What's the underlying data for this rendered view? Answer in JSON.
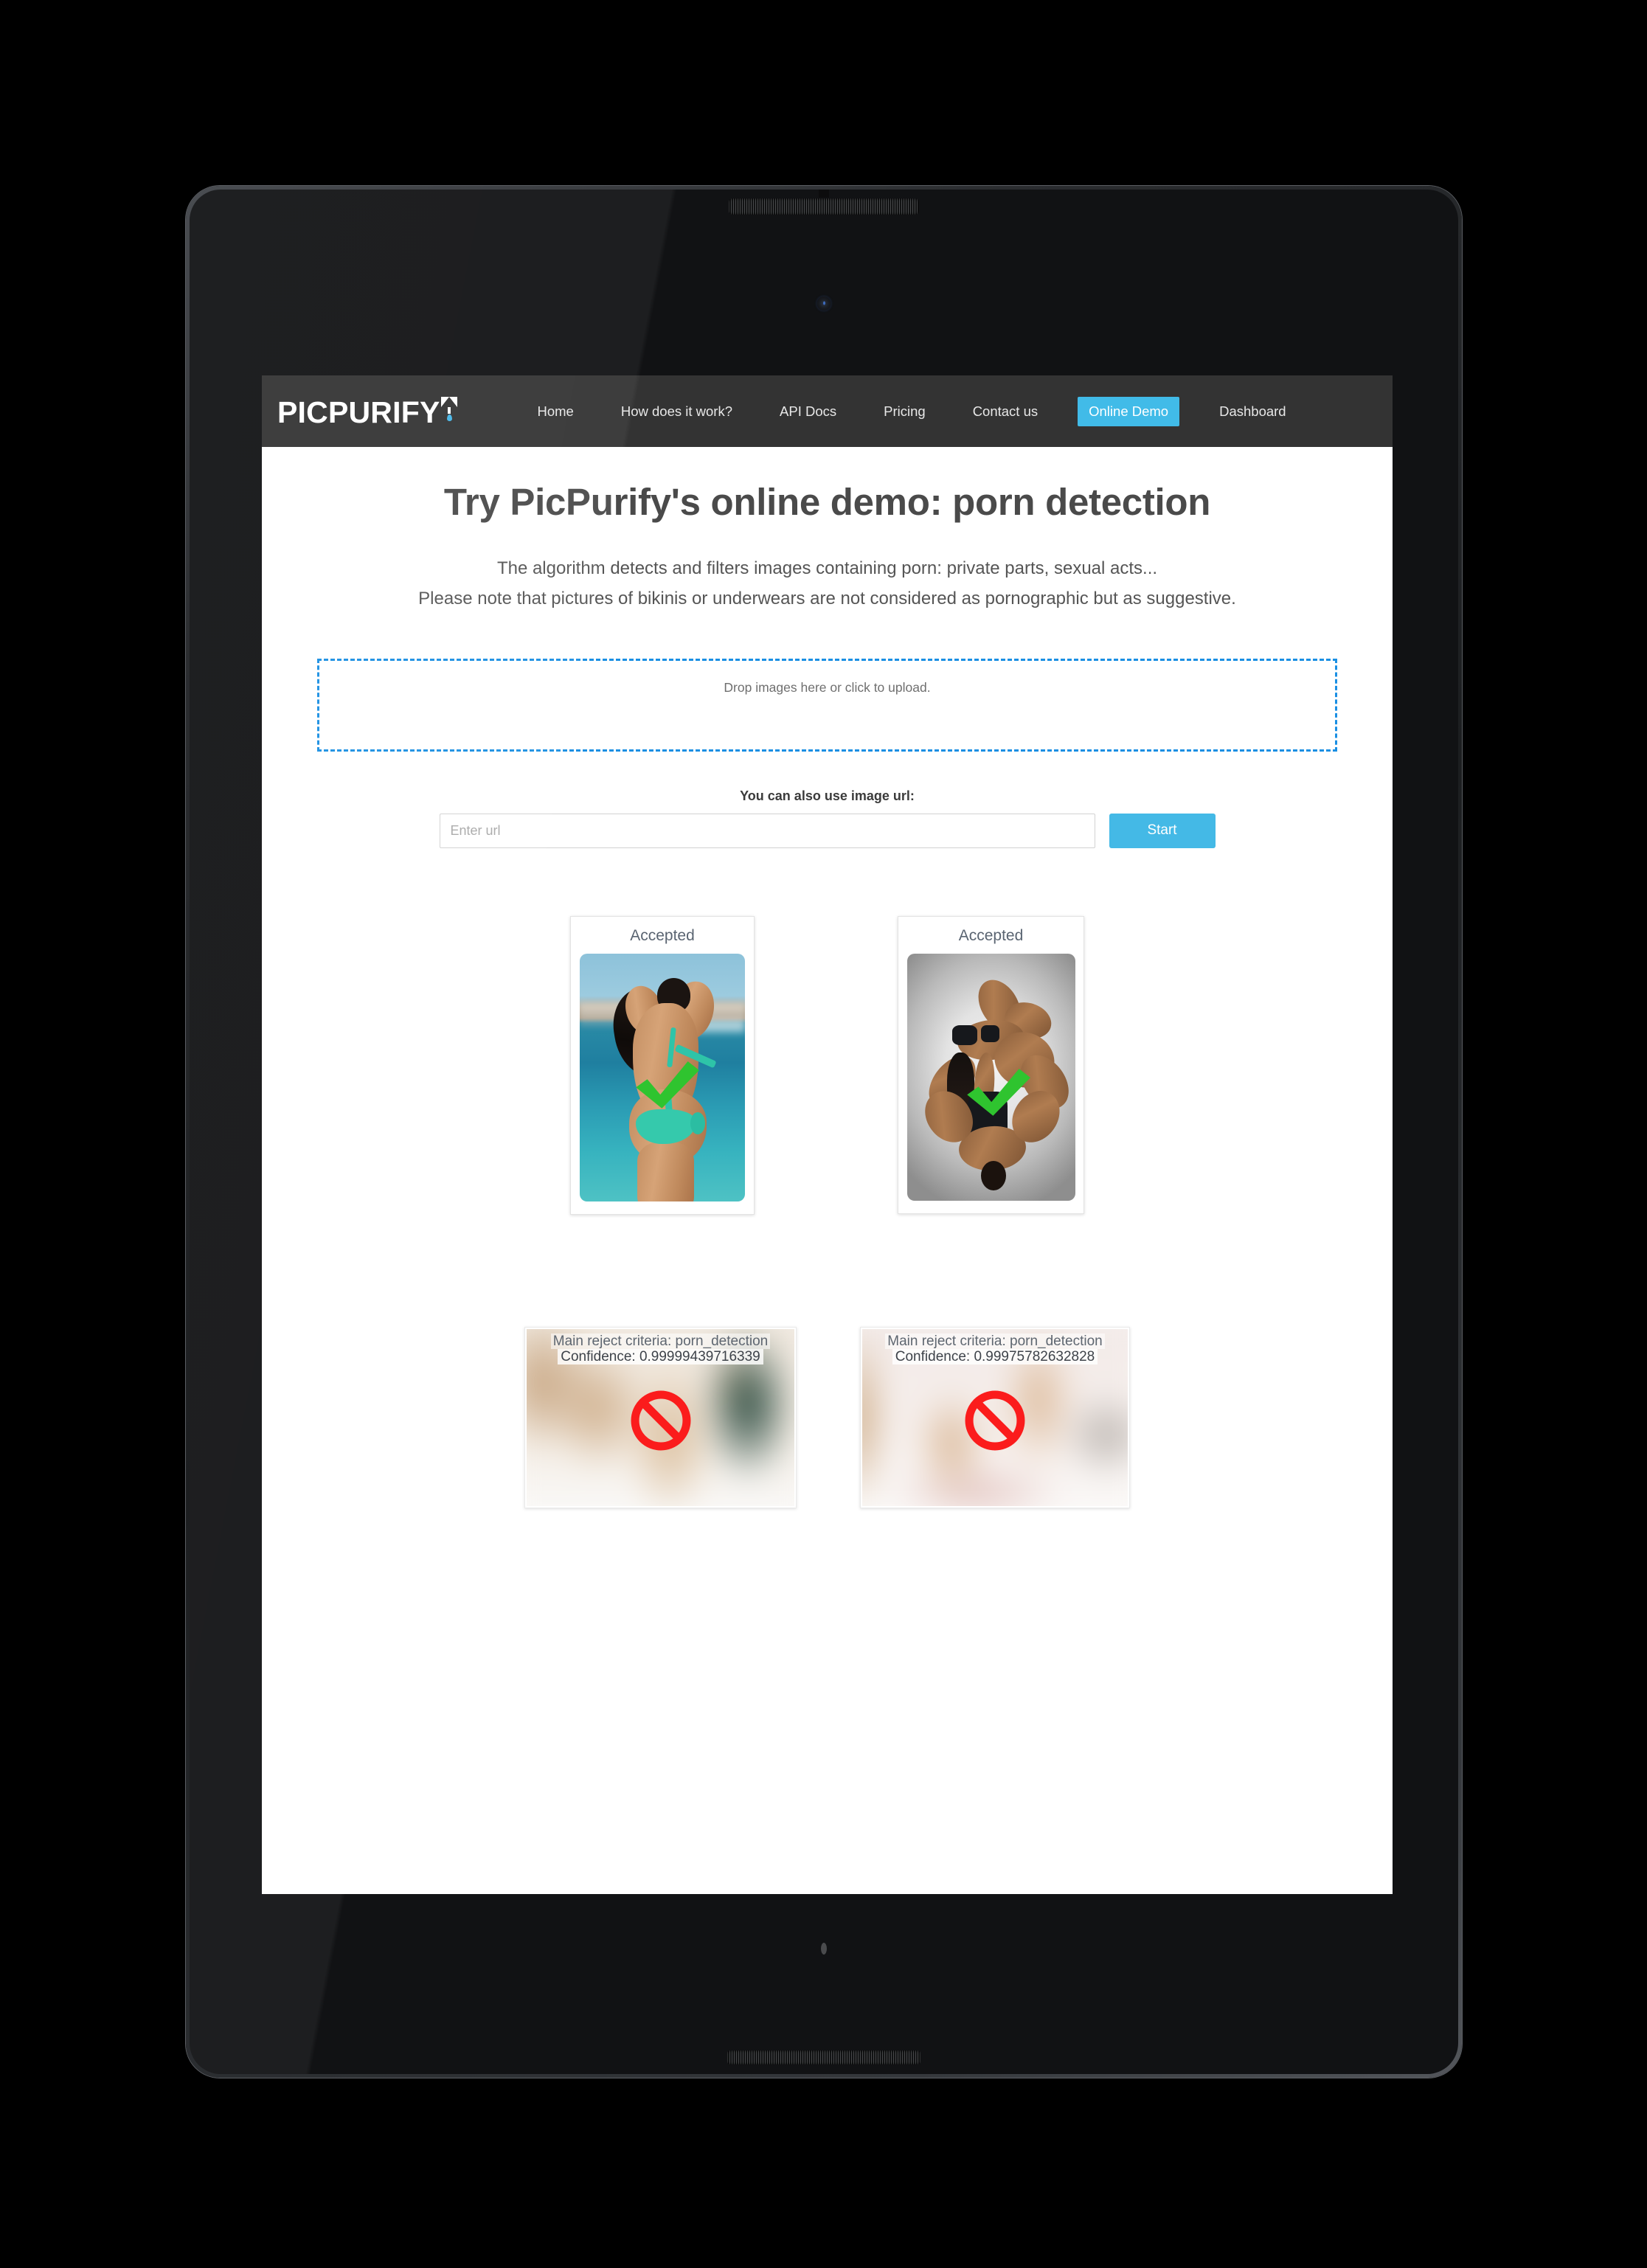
{
  "device": {
    "type": "tablet-mockup",
    "speaker_top": "speaker-grille-icon",
    "camera": "front-camera-icon",
    "speaker_bottom": "speaker-grille-icon",
    "home_indicator": "home-indicator"
  },
  "navbar": {
    "brand": "PICPURIFY",
    "brand_mark": "funnel-droplet-icon",
    "links": [
      {
        "label": "Home",
        "active": false
      },
      {
        "label": "How does it work?",
        "active": false
      },
      {
        "label": "API Docs",
        "active": false
      },
      {
        "label": "Pricing",
        "active": false
      },
      {
        "label": "Contact us",
        "active": false
      },
      {
        "label": "Online Demo",
        "active": true
      },
      {
        "label": "Dashboard",
        "active": false
      }
    ],
    "background_color": "#333333",
    "active_color": "#41bbe8"
  },
  "page": {
    "title": "Try PicPurify's online demo: porn detection",
    "subtitle_line_1": "The algorithm detects and filters images containing porn: private parts, sexual acts...",
    "subtitle_line_2": "Please note that pictures of bikinis or underwears are not considered as pornographic but as suggestive."
  },
  "dropzone": {
    "label": "Drop images here or click to upload.",
    "border_color": "#1a8fe3"
  },
  "url_section": {
    "label": "You can also use image url:",
    "input_value": "",
    "input_placeholder": "Enter url",
    "button_label": "Start",
    "button_color": "#44b9e6"
  },
  "results": {
    "accepted": [
      {
        "status": "Accepted",
        "overlay_icon": "green-check-icon",
        "overlay_color": "#2fc42f",
        "image_alt": "woman in turquoise bikini on beach, seen from behind"
      },
      {
        "status": "Accepted",
        "overlay_icon": "green-check-icon",
        "overlay_color": "#2fc42f",
        "image_alt": "acro-yoga couple in athletic wear on grey backdrop"
      }
    ],
    "rejected": [
      {
        "criteria_label": "Main reject criteria: porn_detection",
        "confidence_label": "Confidence: 0.99999439716339",
        "overlay_icon": "no-entry-icon",
        "overlay_color": "#fb1c1c",
        "blurred": true
      },
      {
        "criteria_label": "Main reject criteria: porn_detection",
        "confidence_label": "Confidence: 0.99975782632828",
        "overlay_icon": "no-entry-icon",
        "overlay_color": "#fb1c1c",
        "blurred": true
      }
    ]
  }
}
